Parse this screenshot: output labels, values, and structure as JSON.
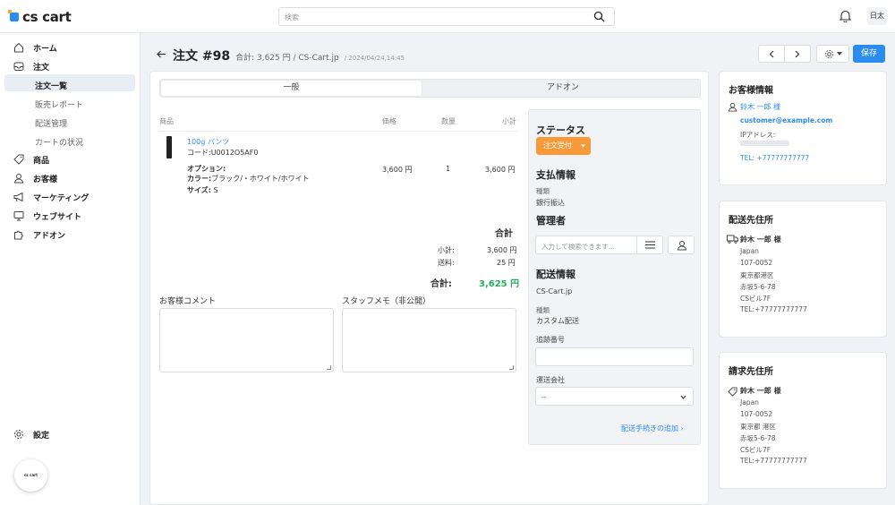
{
  "app": {
    "logo": "cs cart"
  },
  "topbar": {
    "search_placeholder": "検索",
    "user_initials": "日太"
  },
  "sidebar": {
    "items": [
      {
        "label": "ホーム",
        "icon": "home-icon"
      },
      {
        "label": "注文",
        "icon": "inbox-icon"
      },
      {
        "label": "商品",
        "icon": "tag-icon"
      },
      {
        "label": "お客様",
        "icon": "user-icon"
      },
      {
        "label": "マーケティング",
        "icon": "megaphone-icon"
      },
      {
        "label": "ウェブサイト",
        "icon": "monitor-icon"
      },
      {
        "label": "アドオン",
        "icon": "puzzle-icon"
      }
    ],
    "subitems": [
      "注文一覧",
      "販売レポート",
      "配送管理",
      "カートの状況"
    ],
    "settings": "設定",
    "badge": "cs cart"
  },
  "header": {
    "title": "注文 #98",
    "subtitle": "合計: 3,625 円 / CS-Cart.jp",
    "date": "/ 2024/04/24,14:45",
    "save_label": "保存"
  },
  "tabs": [
    "一般",
    "アドオン"
  ],
  "products_table": {
    "headers": [
      "商品",
      "価格",
      "数量",
      "小計"
    ],
    "item": {
      "name": "100g パンツ",
      "code": "コード:U0012O5AF0",
      "options_label": "オプション:",
      "color_label": "カラー:",
      "color_value": "ブラック/・ホワイト/ホワイト",
      "size_label": "サイズ:",
      "size_value": "S",
      "price": "3,600 円",
      "qty": "1",
      "subtotal": "3,600 円"
    }
  },
  "totals": {
    "heading": "合計",
    "subtotal_label": "小計:",
    "subtotal_value": "3,600 円",
    "shipping_label": "送料:",
    "shipping_value": "25 円",
    "total_label": "合計:",
    "total_value": "3,625 円",
    "total_color": "#27ae60"
  },
  "comments": {
    "customer_label": "お客様コメント",
    "staff_label": "スタッフメモ（非公開）"
  },
  "status_panel": {
    "status_heading": "ステータス",
    "status_value": "注文受付",
    "payment_heading": "支払情報",
    "payment_type_label": "種類",
    "payment_type_value": "銀行振込",
    "manager_heading": "管理者",
    "manager_placeholder": "入力して検索できます...",
    "shipping_heading": "配送情報",
    "shipping_site": "CS-Cart.jp",
    "shipping_type_label": "種類",
    "shipping_type_value": "カスタム配送",
    "tracking_label": "追跡番号",
    "carrier_label": "運送会社",
    "carrier_value": "--",
    "add_shipment_link": "配送手続きの追加"
  },
  "customer_card": {
    "title": "お客様情報",
    "name": "鈴木 一郎 様",
    "email": "customer@example.com",
    "ip_label": "IPアドレス:",
    "tel": "TEL: +77777777777"
  },
  "shipping_card": {
    "title": "配送先住所",
    "name": "鈴木 一郎 様",
    "lines": [
      "Japan",
      "107-0052",
      "東京都港区",
      "赤坂5-6-78",
      "CSビル7F",
      "TEL:+77777777777"
    ]
  },
  "billing_card": {
    "title": "請求先住所",
    "name": "鈴木 一郎 様",
    "lines": [
      "Japan",
      "107-0052",
      "東京都 港区",
      "赤坂5-6-78",
      "CSビル7F",
      "TEL:+77777777777"
    ]
  },
  "colors": {
    "accent": "#2b8cf0",
    "status": "#f79a3a"
  }
}
